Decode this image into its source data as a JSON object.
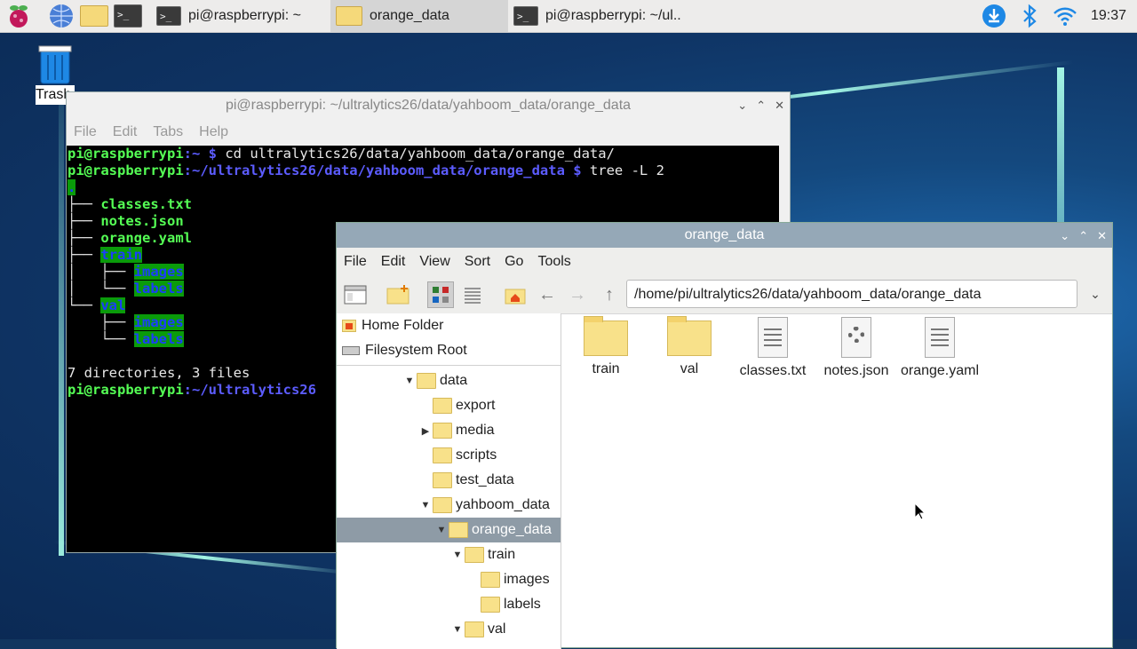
{
  "taskbar": {
    "tasks": [
      {
        "label": "pi@raspberrypi: ~",
        "icon": "terminal-icon"
      },
      {
        "label": "orange_data",
        "icon": "folder-icon"
      },
      {
        "label": "pi@raspberrypi: ~/ul..",
        "icon": "terminal-icon"
      }
    ],
    "clock": "19:37"
  },
  "desktop": {
    "trash_label": "Trash"
  },
  "terminal": {
    "title": "pi@raspberrypi: ~/ultralytics26/data/yahboom_data/orange_data",
    "menu": [
      "File",
      "Edit",
      "Tabs",
      "Help"
    ],
    "lines": {
      "l1_prompt": "pi@raspberrypi",
      "l1_path": ":~ $ ",
      "l1_cmd": "cd ultralytics26/data/yahboom_data/orange_data/",
      "l2_prompt": "pi@raspberrypi",
      "l2_path": ":~/ultralytics26/data/yahboom_data/orange_data $ ",
      "l2_cmd": "tree -L 2",
      "tree_root": ".",
      "f1": "classes.txt",
      "f2": "notes.json",
      "f3": "orange.yaml",
      "d_train": "train",
      "d_train_images": "images",
      "d_train_labels": "labels",
      "d_val": "val",
      "d_val_images": "images",
      "d_val_labels": "labels",
      "summary": "7 directories, 3 files",
      "l_last_prompt": "pi@raspberrypi",
      "l_last_path": ":~/ultralytics26"
    }
  },
  "filemanager": {
    "title": "orange_data",
    "menu": [
      "File",
      "Edit",
      "View",
      "Sort",
      "Go",
      "Tools"
    ],
    "address": "/home/pi/ultralytics26/data/yahboom_data/orange_data",
    "places": [
      "Home Folder",
      "Filesystem Root"
    ],
    "tree": [
      {
        "label": "data",
        "arrow": "▼"
      },
      {
        "label": "export",
        "arrow": ""
      },
      {
        "label": "media",
        "arrow": "▶"
      },
      {
        "label": "scripts",
        "arrow": ""
      },
      {
        "label": "test_data",
        "arrow": ""
      },
      {
        "label": "yahboom_data",
        "arrow": "▼"
      },
      {
        "label": "orange_data",
        "arrow": "▼"
      },
      {
        "label": "train",
        "arrow": "▼"
      },
      {
        "label": "images",
        "arrow": ""
      },
      {
        "label": "labels",
        "arrow": ""
      },
      {
        "label": "val",
        "arrow": "▼"
      }
    ],
    "items": [
      "train",
      "val",
      "classes.txt",
      "notes.json",
      "orange.yaml"
    ]
  }
}
